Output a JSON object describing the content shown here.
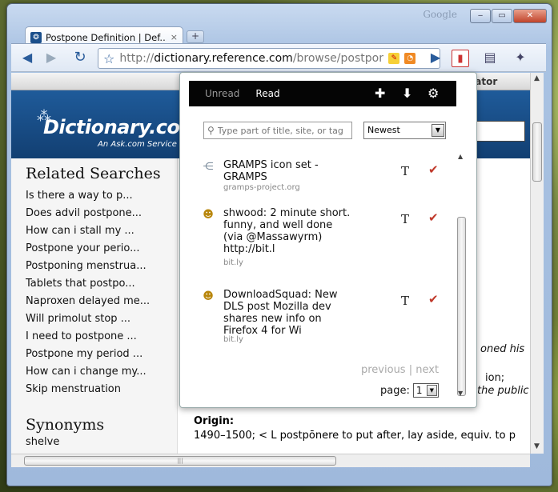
{
  "window": {
    "caption": "Google",
    "min": "‒",
    "max": "▭",
    "close": "✕"
  },
  "tab": {
    "title": "Postpone Definition | Def...",
    "close": "×",
    "new_tab": "+"
  },
  "omnibox": {
    "prefix": "http://",
    "host": "dictionary.reference.com",
    "path": "/browse/postpone"
  },
  "site": {
    "nav_text": "slator",
    "logo": "Dictionary.com",
    "logo_sub": "An Ask.com Service"
  },
  "sidebar": {
    "related_heading": "Related Searches",
    "related": [
      "Is there a way to p...",
      "Does advil postpone...",
      "How can i stall my ...",
      "Postpone your perio...",
      "Postponing menstrua...",
      "Tablets that postpo...",
      "Naproxen delayed me...",
      "Will primolut stop ...",
      "I need to postpone ...",
      "Postpone my period ...",
      "How can i change my...",
      "Skip menstruation"
    ],
    "synonyms_heading": "Synonyms",
    "synonyms": [
      "shelve"
    ]
  },
  "main": {
    "frag1": "oned his",
    "frag2": "ion;",
    "frag3": "the public",
    "origin_heading": "Origin:",
    "origin_text": "1490–1500; < L postpōnere to put after, lay aside, equiv. to p"
  },
  "popup": {
    "tabs": {
      "unread": "Unread",
      "read": "Read"
    },
    "search_placeholder": "Type part of title, site, or tag",
    "sort_selected": "Newest",
    "items": [
      {
        "icon": "gramps-icon",
        "title": "GRAMPS icon set - GRAMPS",
        "site": "gramps-project.org"
      },
      {
        "icon": "avatar-icon",
        "title": "shwood: 2 minute short. funny, and well done (via @Massawyrm) http://bit.l",
        "site": "bit.ly"
      },
      {
        "icon": "avatar-icon",
        "title": "DownloadSquad: New DLS post Mozilla dev shares new info on Firefox 4 for Wi",
        "site": "bit.ly"
      }
    ],
    "tag_glyph": "T",
    "check_glyph": "✔",
    "pager": {
      "previous": "previous",
      "separator": "|",
      "next": "next"
    },
    "page_label": "page:",
    "page_value": "1"
  },
  "colors": {
    "accent": "#2a5c9b",
    "check": "#c0392b",
    "popup_bar": "#050505"
  }
}
